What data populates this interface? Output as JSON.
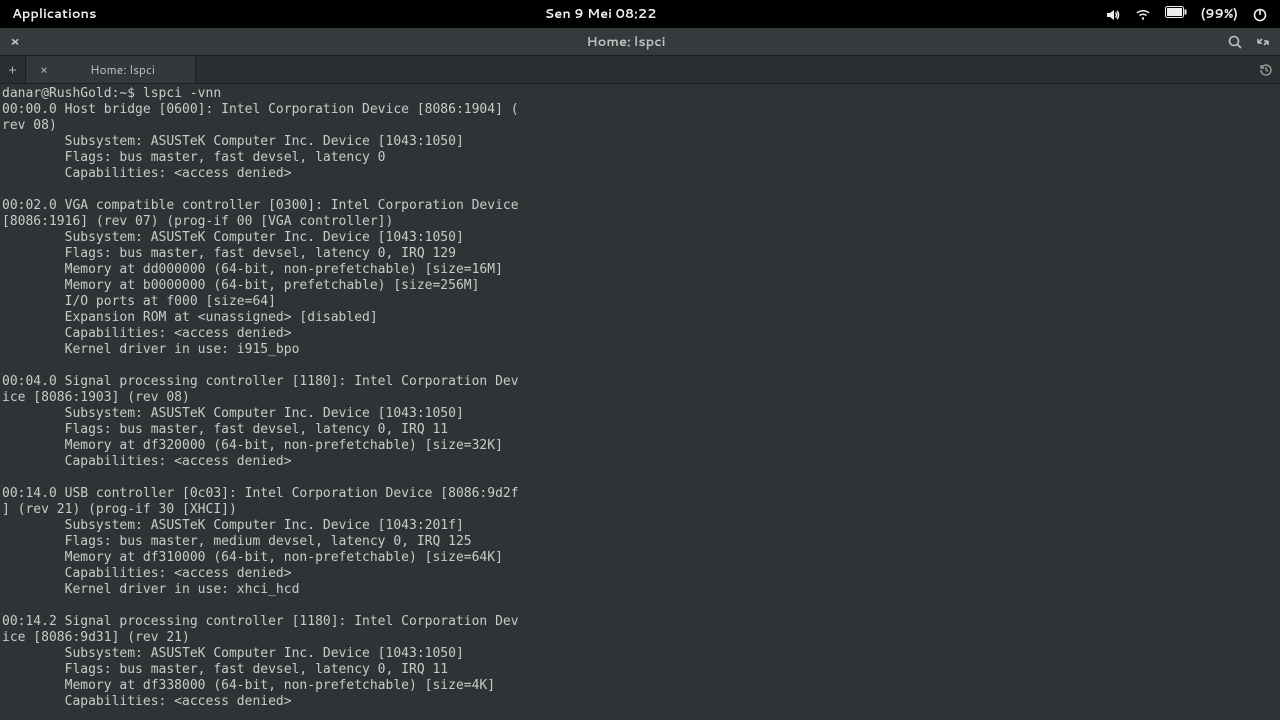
{
  "topbar": {
    "applications_label": "Applications",
    "clock": "Sen  9 Mei   08:22",
    "battery_pct": "(99%)"
  },
  "window": {
    "title": "Home: lspci",
    "close_x": "×"
  },
  "tabs": {
    "add_label": "+",
    "close_x": "×",
    "tab0_label": "Home: lspci"
  },
  "terminal": {
    "prompt": "danar@RushGold:~$ ",
    "command": "lspci -vnn",
    "output": "00:00.0 Host bridge [0600]: Intel Corporation Device [8086:1904] (\nrev 08)\n        Subsystem: ASUSTeK Computer Inc. Device [1043:1050]\n        Flags: bus master, fast devsel, latency 0\n        Capabilities: <access denied>\n\n00:02.0 VGA compatible controller [0300]: Intel Corporation Device\n[8086:1916] (rev 07) (prog-if 00 [VGA controller])\n        Subsystem: ASUSTeK Computer Inc. Device [1043:1050]\n        Flags: bus master, fast devsel, latency 0, IRQ 129\n        Memory at dd000000 (64-bit, non-prefetchable) [size=16M]\n        Memory at b0000000 (64-bit, prefetchable) [size=256M]\n        I/O ports at f000 [size=64]\n        Expansion ROM at <unassigned> [disabled]\n        Capabilities: <access denied>\n        Kernel driver in use: i915_bpo\n\n00:04.0 Signal processing controller [1180]: Intel Corporation Dev\nice [8086:1903] (rev 08)\n        Subsystem: ASUSTeK Computer Inc. Device [1043:1050]\n        Flags: bus master, fast devsel, latency 0, IRQ 11\n        Memory at df320000 (64-bit, non-prefetchable) [size=32K]\n        Capabilities: <access denied>\n\n00:14.0 USB controller [0c03]: Intel Corporation Device [8086:9d2f\n] (rev 21) (prog-if 30 [XHCI])\n        Subsystem: ASUSTeK Computer Inc. Device [1043:201f]\n        Flags: bus master, medium devsel, latency 0, IRQ 125\n        Memory at df310000 (64-bit, non-prefetchable) [size=64K]\n        Capabilities: <access denied>\n        Kernel driver in use: xhci_hcd\n\n00:14.2 Signal processing controller [1180]: Intel Corporation Dev\nice [8086:9d31] (rev 21)\n        Subsystem: ASUSTeK Computer Inc. Device [1043:1050]\n        Flags: bus master, fast devsel, latency 0, IRQ 11\n        Memory at df338000 (64-bit, non-prefetchable) [size=4K]\n        Capabilities: <access denied>"
  }
}
